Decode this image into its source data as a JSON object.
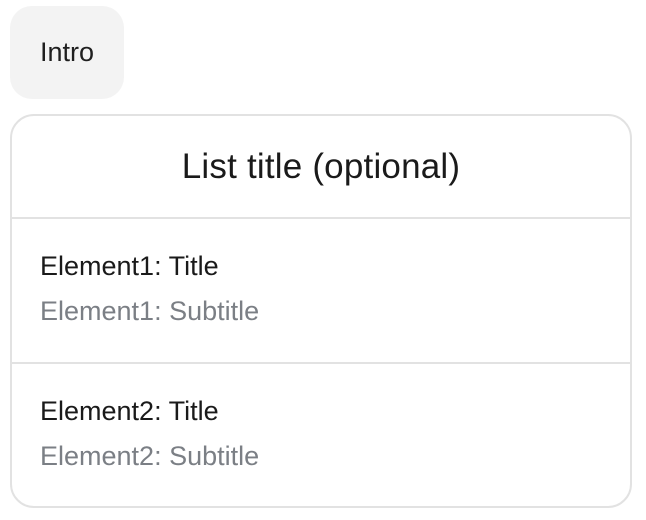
{
  "intro": {
    "text": "Intro"
  },
  "list": {
    "title": "List title (optional)",
    "items": [
      {
        "title": "Element1: Title",
        "subtitle": "Element1: Subtitle"
      },
      {
        "title": "Element2: Title",
        "subtitle": "Element2: Subtitle"
      }
    ]
  },
  "colors": {
    "bubble_background": "#f3f3f3",
    "card_border": "#e2e2e2",
    "text_primary": "#1a1a1a",
    "text_secondary": "#7b7f85"
  }
}
